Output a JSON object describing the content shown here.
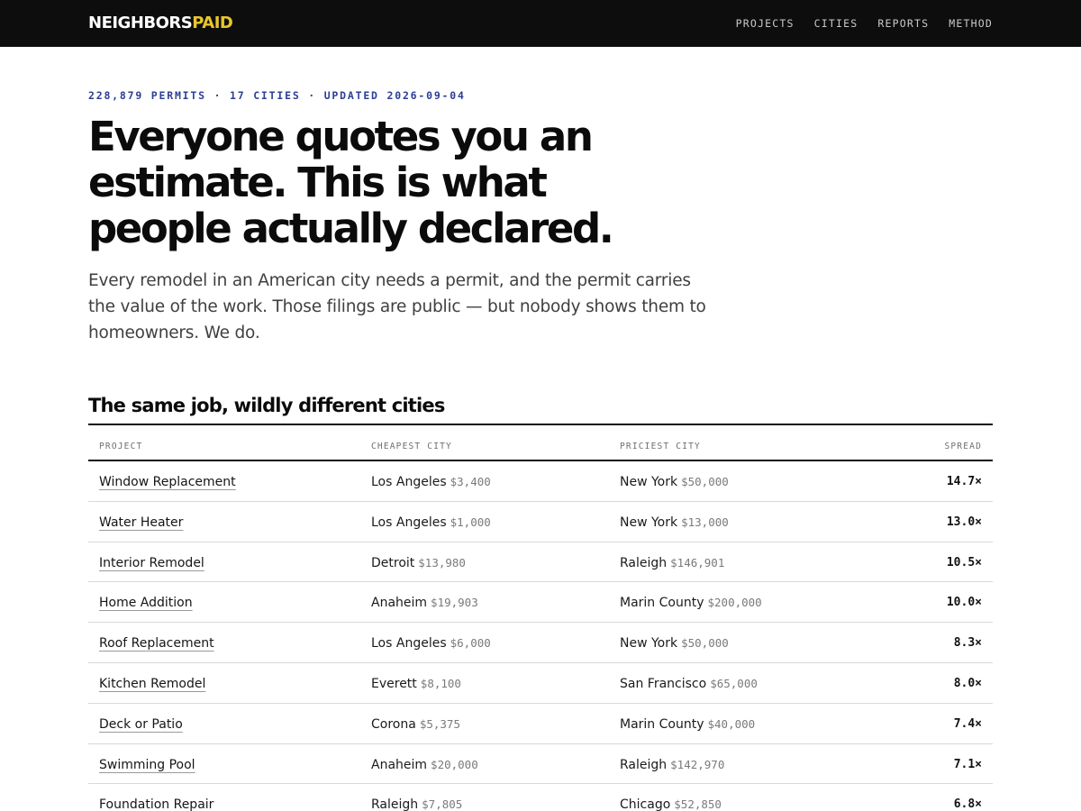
{
  "header": {
    "logo_part1": "NEIGHBORS",
    "logo_part2": "PAID",
    "nav": [
      "PROJECTS",
      "CITIES",
      "REPORTS",
      "METHOD"
    ]
  },
  "hero": {
    "meta": "228,879 PERMITS · 17 CITIES · UPDATED 2026-09-04",
    "headline": "Everyone quotes you an estimate. This is what people actually declared.",
    "lede": "Every remodel in an American city needs a permit, and the permit carries the value of the work. Those filings are public — but nobody shows them to homeowners. We do."
  },
  "comparison": {
    "title": "The same job, wildly different cities",
    "columns": [
      "PROJECT",
      "CHEAPEST CITY",
      "PRICIEST CITY",
      "SPREAD"
    ],
    "rows": [
      {
        "project": "Window Replacement",
        "cheap_city": "Los Angeles",
        "cheap_price": "$3,400",
        "pricey_city": "New York",
        "pricey_price": "$50,000",
        "spread": "14.7×"
      },
      {
        "project": "Water Heater",
        "cheap_city": "Los Angeles",
        "cheap_price": "$1,000",
        "pricey_city": "New York",
        "pricey_price": "$13,000",
        "spread": "13.0×"
      },
      {
        "project": "Interior Remodel",
        "cheap_city": "Detroit",
        "cheap_price": "$13,980",
        "pricey_city": "Raleigh",
        "pricey_price": "$146,901",
        "spread": "10.5×"
      },
      {
        "project": "Home Addition",
        "cheap_city": "Anaheim",
        "cheap_price": "$19,903",
        "pricey_city": "Marin County",
        "pricey_price": "$200,000",
        "spread": "10.0×"
      },
      {
        "project": "Roof Replacement",
        "cheap_city": "Los Angeles",
        "cheap_price": "$6,000",
        "pricey_city": "New York",
        "pricey_price": "$50,000",
        "spread": "8.3×"
      },
      {
        "project": "Kitchen Remodel",
        "cheap_city": "Everett",
        "cheap_price": "$8,100",
        "pricey_city": "San Francisco",
        "pricey_price": "$65,000",
        "spread": "8.0×"
      },
      {
        "project": "Deck or Patio",
        "cheap_city": "Corona",
        "cheap_price": "$5,375",
        "pricey_city": "Marin County",
        "pricey_price": "$40,000",
        "spread": "7.4×"
      },
      {
        "project": "Swimming Pool",
        "cheap_city": "Anaheim",
        "cheap_price": "$20,000",
        "pricey_city": "Raleigh",
        "pricey_price": "$142,970",
        "spread": "7.1×"
      },
      {
        "project": "Foundation Repair",
        "cheap_city": "Raleigh",
        "cheap_price": "$7,805",
        "pricey_city": "Chicago",
        "pricey_price": "$52,850",
        "spread": "6.8×"
      }
    ]
  },
  "colors": {
    "topbar": "#0d0d0d",
    "logo_accent": "#e7c62a",
    "meta_blue": "#2c3f94"
  }
}
